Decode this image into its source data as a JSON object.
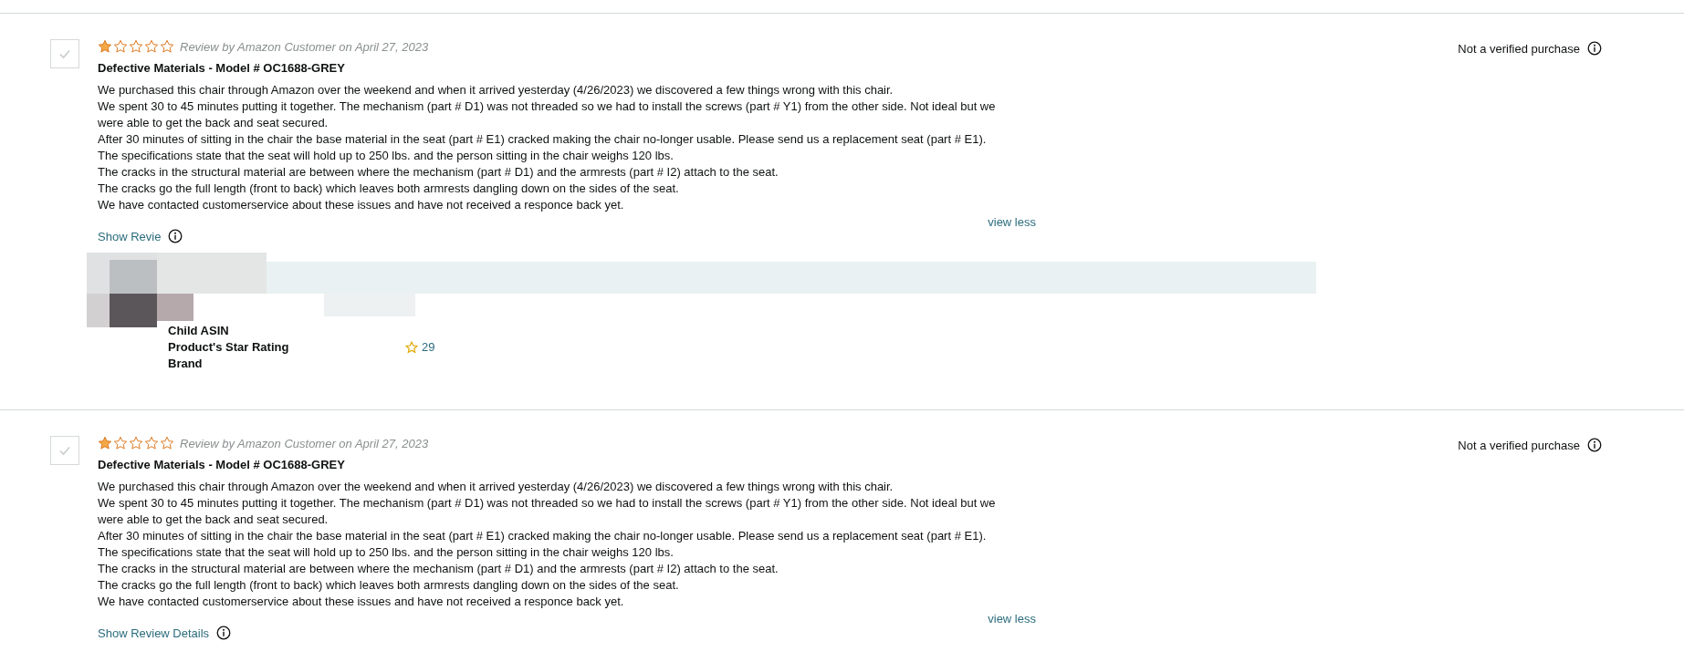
{
  "reviews": [
    {
      "checked": false,
      "stars": 1,
      "byline": "Review by Amazon Customer on April 27, 2023",
      "title": "Defective Materials - Model # OC1688-GREY",
      "body": [
        "We purchased this chair through Amazon over the weekend and when it arrived yesterday (4/26/2023) we discovered a few things wrong with this chair.",
        "We spent 30 to 45 minutes putting it together. The mechanism (part # D1) was not threaded so we had to install the screws (part # Y1) from the other side. Not ideal but we were able to get the back and seat secured.",
        "After 30 minutes of sitting in the chair the base material in the seat (part # E1) cracked making the chair no-longer usable. Please send us a replacement seat (part # E1).",
        "The specifications state that the seat will hold up to 250 lbs. and the person sitting in the chair weighs 120 lbs.",
        "The cracks in the structural material are between where the mechanism (part # D1) and the armrests (part # I2) attach to the seat.",
        "The cracks go the full length (front to back) which leaves both armrests dangling down on the sides of the seat.",
        "We have contacted customerservice about these issues and have not received a responce back yet."
      ],
      "verification": "Not a verified purchase",
      "toggle": "view less",
      "details_link": "Show Revie",
      "details": [
        {
          "label": "Child ASIN"
        },
        {
          "label": "Product's Star Rating",
          "value": "29"
        },
        {
          "label": "Brand"
        }
      ]
    },
    {
      "checked": false,
      "stars": 1,
      "byline": "Review by Amazon Customer on April 27, 2023",
      "title": "Defective Materials - Model # OC1688-GREY",
      "body": [
        "We purchased this chair through Amazon over the weekend and when it arrived yesterday (4/26/2023) we discovered a few things wrong with this chair.",
        "We spent 30 to 45 minutes putting it together. The mechanism (part # D1) was not threaded so we had to install the screws (part # Y1) from the other side. Not ideal but we were able to get the back and seat secured.",
        "After 30 minutes of sitting in the chair the base material in the seat (part # E1) cracked making the chair no-longer usable. Please send us a replacement seat (part # E1).",
        "The specifications state that the seat will hold up to 250 lbs. and the person sitting in the chair weighs 120 lbs.",
        "The cracks in the structural material are between where the mechanism (part # D1) and the armrests (part # I2) attach to the seat.",
        "The cracks go the full length (front to back) which leaves both armrests dangling down on the sides of the seat.",
        "We have contacted customerservice about these issues and have not received a responce back yet."
      ],
      "verification": "Not a verified purchase",
      "toggle": "view less",
      "details_link": "Show Review Details"
    }
  ]
}
